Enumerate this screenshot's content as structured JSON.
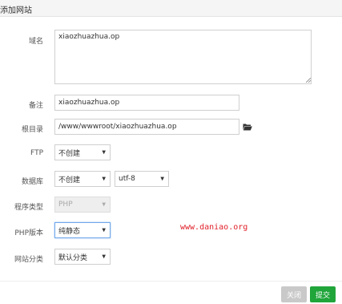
{
  "dialog": {
    "title": "添加网站"
  },
  "form": {
    "domain": {
      "label": "域名",
      "value": "xiaozhuazhua.op"
    },
    "remark": {
      "label": "备注",
      "value": "xiaozhuazhua.op"
    },
    "root": {
      "label": "根目录",
      "value": "/www/wwwroot/xiaozhuazhua.op",
      "icon": "folder-open-icon"
    },
    "ftp": {
      "label": "FTP",
      "selected": "不创建"
    },
    "database": {
      "label": "数据库",
      "selected": "不创建",
      "charset": "utf-8"
    },
    "program_type": {
      "label": "程序类型",
      "selected": "PHP"
    },
    "php_version": {
      "label": "PHP版本",
      "selected": "纯静态"
    },
    "category": {
      "label": "网站分类",
      "selected": "默认分类"
    }
  },
  "watermark": "www.daniao.org",
  "footer": {
    "close_label": "关闭",
    "submit_label": "提交"
  },
  "colors": {
    "submit": "#20a53a",
    "close": "#c9c9c9",
    "watermark": "#e0202a",
    "focus": "#6fa7e8"
  }
}
